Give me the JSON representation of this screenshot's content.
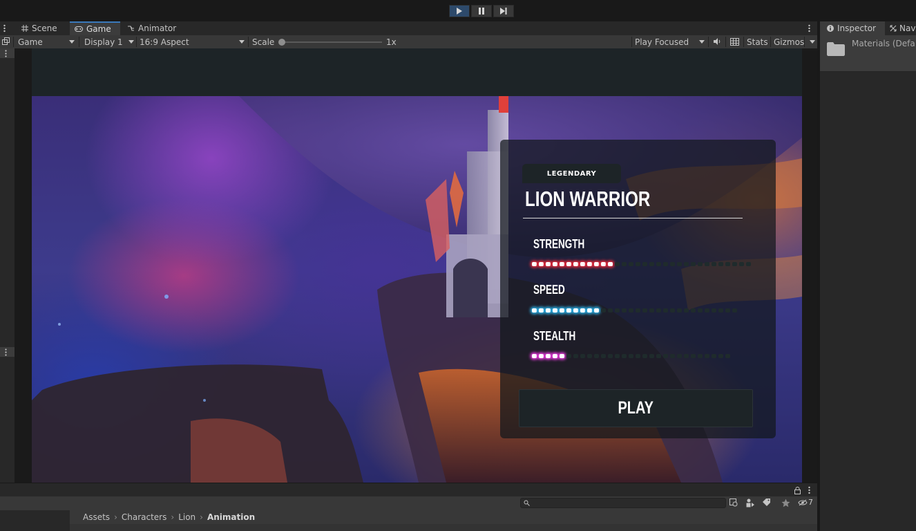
{
  "toolbar": {
    "play_icon": "play-icon",
    "pause_icon": "pause-icon",
    "step_icon": "step-icon",
    "accent": "#3a79bb"
  },
  "tabs": [
    {
      "label": "Scene",
      "icon": "grid-icon"
    },
    {
      "label": "Game",
      "icon": "gamepad-icon",
      "active": true
    },
    {
      "label": "Animator",
      "icon": "animator-icon"
    }
  ],
  "options": {
    "display_type": "Game",
    "display": "Display 1",
    "aspect": "16:9 Aspect",
    "scale_label": "Scale",
    "scale_value": "1x",
    "scale_level": 0,
    "play_mode": "Play Focused",
    "stats": "Stats",
    "gizmos": "Gizmos"
  },
  "game": {
    "badge": "LEGENDARY",
    "title": "LION WARRIOR",
    "stats": [
      {
        "label": "STRENGTH",
        "filled": 12,
        "total": 32,
        "color": "#ff2a3a"
      },
      {
        "label": "SPEED",
        "filled": 10,
        "total": 30,
        "color": "#2ec3ff"
      },
      {
        "label": "STEALTH",
        "filled": 5,
        "total": 29,
        "color": "#ff3cf2"
      }
    ],
    "play_label": "PLAY"
  },
  "inspector": {
    "tab_label": "Inspector",
    "second_tab": "Nav",
    "item_label": "Materials (Defa"
  },
  "project": {
    "hidden_count": "7",
    "breadcrumb": [
      "Assets",
      "Characters",
      "Lion",
      "Animation"
    ]
  }
}
